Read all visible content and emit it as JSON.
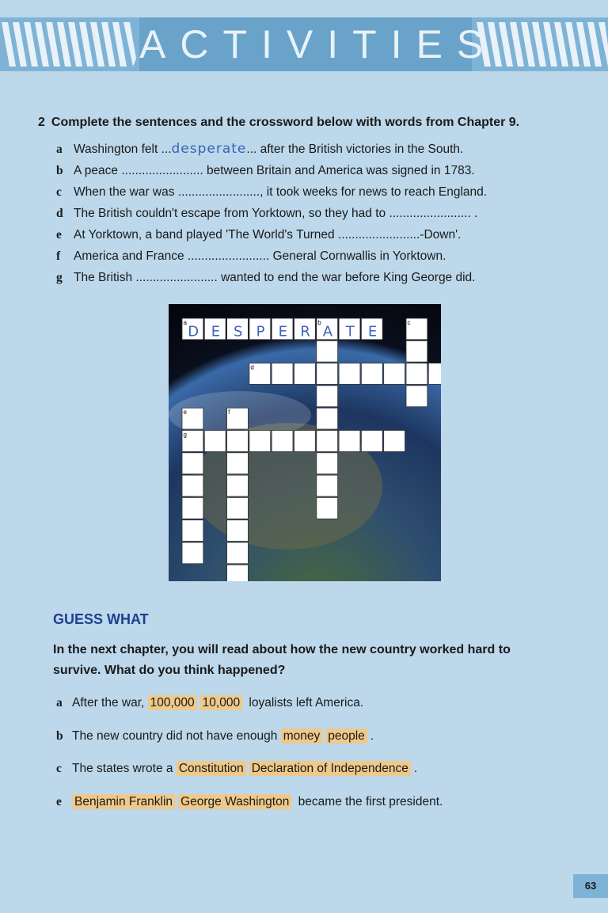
{
  "banner": {
    "title": "ACTIVITIES"
  },
  "exercise": {
    "number": "2",
    "instruction": "Complete the sentences and the crossword below with words from Chapter 9.",
    "items": [
      {
        "letter": "a",
        "before": "Washington felt",
        "dots_before": "...",
        "answer": "desperate",
        "dots_after": "...",
        "after": " after the British victories in the South."
      },
      {
        "letter": "b",
        "before": "A peace",
        "dots_before": "........................",
        "answer": "",
        "dots_after": "",
        "after": " between Britain and America was signed in 1783."
      },
      {
        "letter": "c",
        "before": "When the war was",
        "dots_before": "........................",
        "answer": "",
        "dots_after": "",
        "after": ", it took weeks for news to reach England."
      },
      {
        "letter": "d",
        "before": "The British couldn't escape from Yorktown, so they had to",
        "dots_before": "........................",
        "answer": "",
        "dots_after": "",
        "after": " ."
      },
      {
        "letter": "e",
        "before": "At Yorktown, a band played 'The World's Turned",
        "dots_before": "........................",
        "answer": "",
        "dots_after": "",
        "after": "-Down'."
      },
      {
        "letter": "f",
        "before": "America and France",
        "dots_before": "........................",
        "answer": "",
        "dots_after": "",
        "after": " General Cornwallis in Yorktown."
      },
      {
        "letter": "g",
        "before": "The British",
        "dots_before": "........................",
        "answer": "",
        "dots_after": "",
        "after": " wanted to end the war before King George did."
      }
    ]
  },
  "crossword": {
    "answer_a": "DESPERATE",
    "clue_labels": [
      "a",
      "b",
      "c",
      "d",
      "e",
      "f",
      "g"
    ]
  },
  "guess": {
    "title": "GUESS WHAT",
    "question": "In the next chapter, you will read about how the new country worked hard to survive. What do you think happened?",
    "options": [
      {
        "letter": "a",
        "before": "After the war,",
        "choice1": "100,000",
        "choice2": "10,000",
        "after": " loyalists left America."
      },
      {
        "letter": "b",
        "before": "The new country did not have enough",
        "choice1": "money",
        "choice2": "people",
        "after": "."
      },
      {
        "letter": "c",
        "before": "The states wrote a",
        "choice1": "Constitution",
        "choice2": "Declaration of Independence",
        "after": "."
      },
      {
        "letter": "e",
        "before": "",
        "choice1": "Benjamin Franklin",
        "choice2": "George Washington",
        "after": " became the first president."
      }
    ]
  },
  "page_number": "63",
  "colors": {
    "highlight": "#efc98a",
    "background": "#bcd8ea",
    "heading_blue": "#1f3f8f",
    "handwriting": "#3b63b8"
  }
}
